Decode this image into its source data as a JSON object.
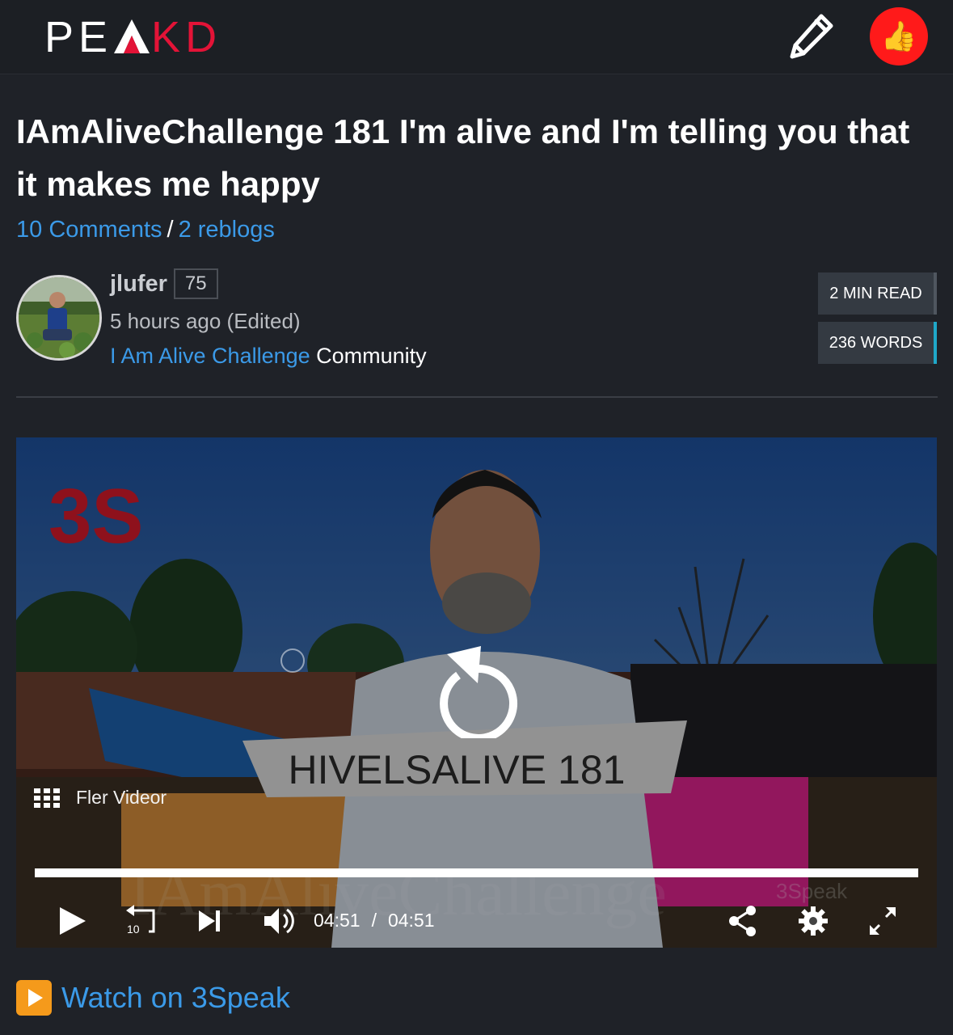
{
  "header": {
    "logo_left": "PE",
    "logo_right": "KD",
    "logo_wordmark": "PEAKD",
    "edit_icon": "pencil-icon",
    "vote_icon": "thumbs-up-icon",
    "vote_emoji": "👍"
  },
  "post": {
    "title": "IAmAliveChallenge 181 I'm alive and I'm telling you that it makes me happy",
    "comments_label": "10 Comments",
    "separator": "/",
    "reblogs_label": "2 reblogs"
  },
  "author": {
    "name": "jlufer",
    "reputation": "75",
    "time": "5 hours ago (Edited)",
    "community_name": "I Am Alive Challenge",
    "community_suffix": "Community"
  },
  "stats": {
    "read_time": "2 MIN READ",
    "word_count": "236 WORDS"
  },
  "video": {
    "brand_mark": "3S",
    "overlay_banner": "HIVELSALIVE 181",
    "watermark": "IAmAliveChallenge",
    "watermark_brand": "3Speak",
    "more_videos_label": "Fler Videor",
    "progress": 1.0,
    "current_time": "04:51",
    "time_separator": "/",
    "duration": "04:51",
    "rewind_seconds": "10",
    "icons": [
      "replay-icon",
      "grid-icon",
      "play-icon",
      "rewind-10-icon",
      "next-icon",
      "volume-icon",
      "share-icon",
      "settings-icon",
      "fullscreen-icon"
    ]
  },
  "footer_link": {
    "label": "Watch on 3Speak",
    "icon": "play-button-emoji-icon"
  },
  "colors": {
    "background": "#1f2228",
    "link": "#3b9ae8",
    "brand_red": "#e31337",
    "vote_red": "#ff1a1a",
    "word_count_accent": "#1fa8c9"
  }
}
